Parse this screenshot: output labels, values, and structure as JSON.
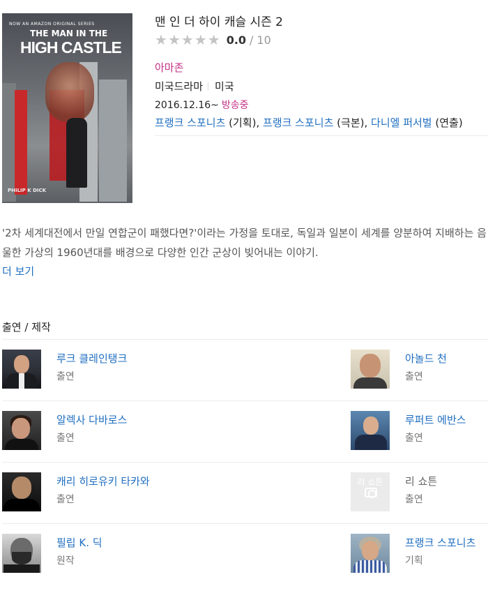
{
  "poster": {
    "top_line": "NOW AN AMAZON ORIGINAL SERIES",
    "title_line1": "THE MAN IN THE",
    "title_line2": "HIGH CASTLE",
    "author": "PHILIP K DICK"
  },
  "info": {
    "title": "맨 인 더 하이 캐슬 시즌 2",
    "rating": "0.0",
    "rating_sep": "/",
    "rating_max": "10",
    "network": "아마존",
    "genre": "미국드라마",
    "country": "미국",
    "date": "2016.12.16~",
    "status": "방송중",
    "credits": [
      {
        "name": "프랭크 스포니츠",
        "role": "(기획)"
      },
      {
        "name": "프랭크 스포니츠",
        "role": "(극본)"
      },
      {
        "name": "다니엘 퍼서벌",
        "role": "(연출)"
      }
    ],
    "credit_sep": ", "
  },
  "synopsis": {
    "text": "'2차 세계대전에서 만일 연합군이 패했다면?'이라는 가정을 토대로, 독일과 일본이 세계를 양분하여 지배하는 음울한 가상의 1960년대를 배경으로 다양한 인간 군상이 빚어내는 이야기.",
    "more_label": "더 보기"
  },
  "cast": {
    "heading": "출연 / 제작",
    "rows": [
      {
        "left": {
          "name": "루크 클레인탱크",
          "role": "출연",
          "photo_icon": "person-photo"
        },
        "right": {
          "name": "아놀드 천",
          "role": "출연",
          "photo_icon": "person-photo"
        }
      },
      {
        "left": {
          "name": "알렉사 다바로스",
          "role": "출연",
          "photo_icon": "person-photo"
        },
        "right": {
          "name": "루퍼트 에반스",
          "role": "출연",
          "photo_icon": "person-photo"
        }
      },
      {
        "left": {
          "name": "캐리 히로유키 타카와",
          "role": "출연",
          "photo_icon": "person-photo"
        },
        "right": {
          "name": "리 쇼튼",
          "role": "출연",
          "photo_icon": "no-photo-placeholder",
          "placeholder_text": "리 쇼튼"
        }
      },
      {
        "left": {
          "name": "필립 K. 딕",
          "role": "원작",
          "photo_icon": "person-photo"
        },
        "right": {
          "name": "프랭크 스포니츠",
          "role": "기획",
          "photo_icon": "person-photo"
        }
      }
    ]
  },
  "colors": {
    "link": "#1f6ec0",
    "accent_pink": "#c42f85",
    "star_empty": "#c4c4c4",
    "divider": "#ececec"
  }
}
